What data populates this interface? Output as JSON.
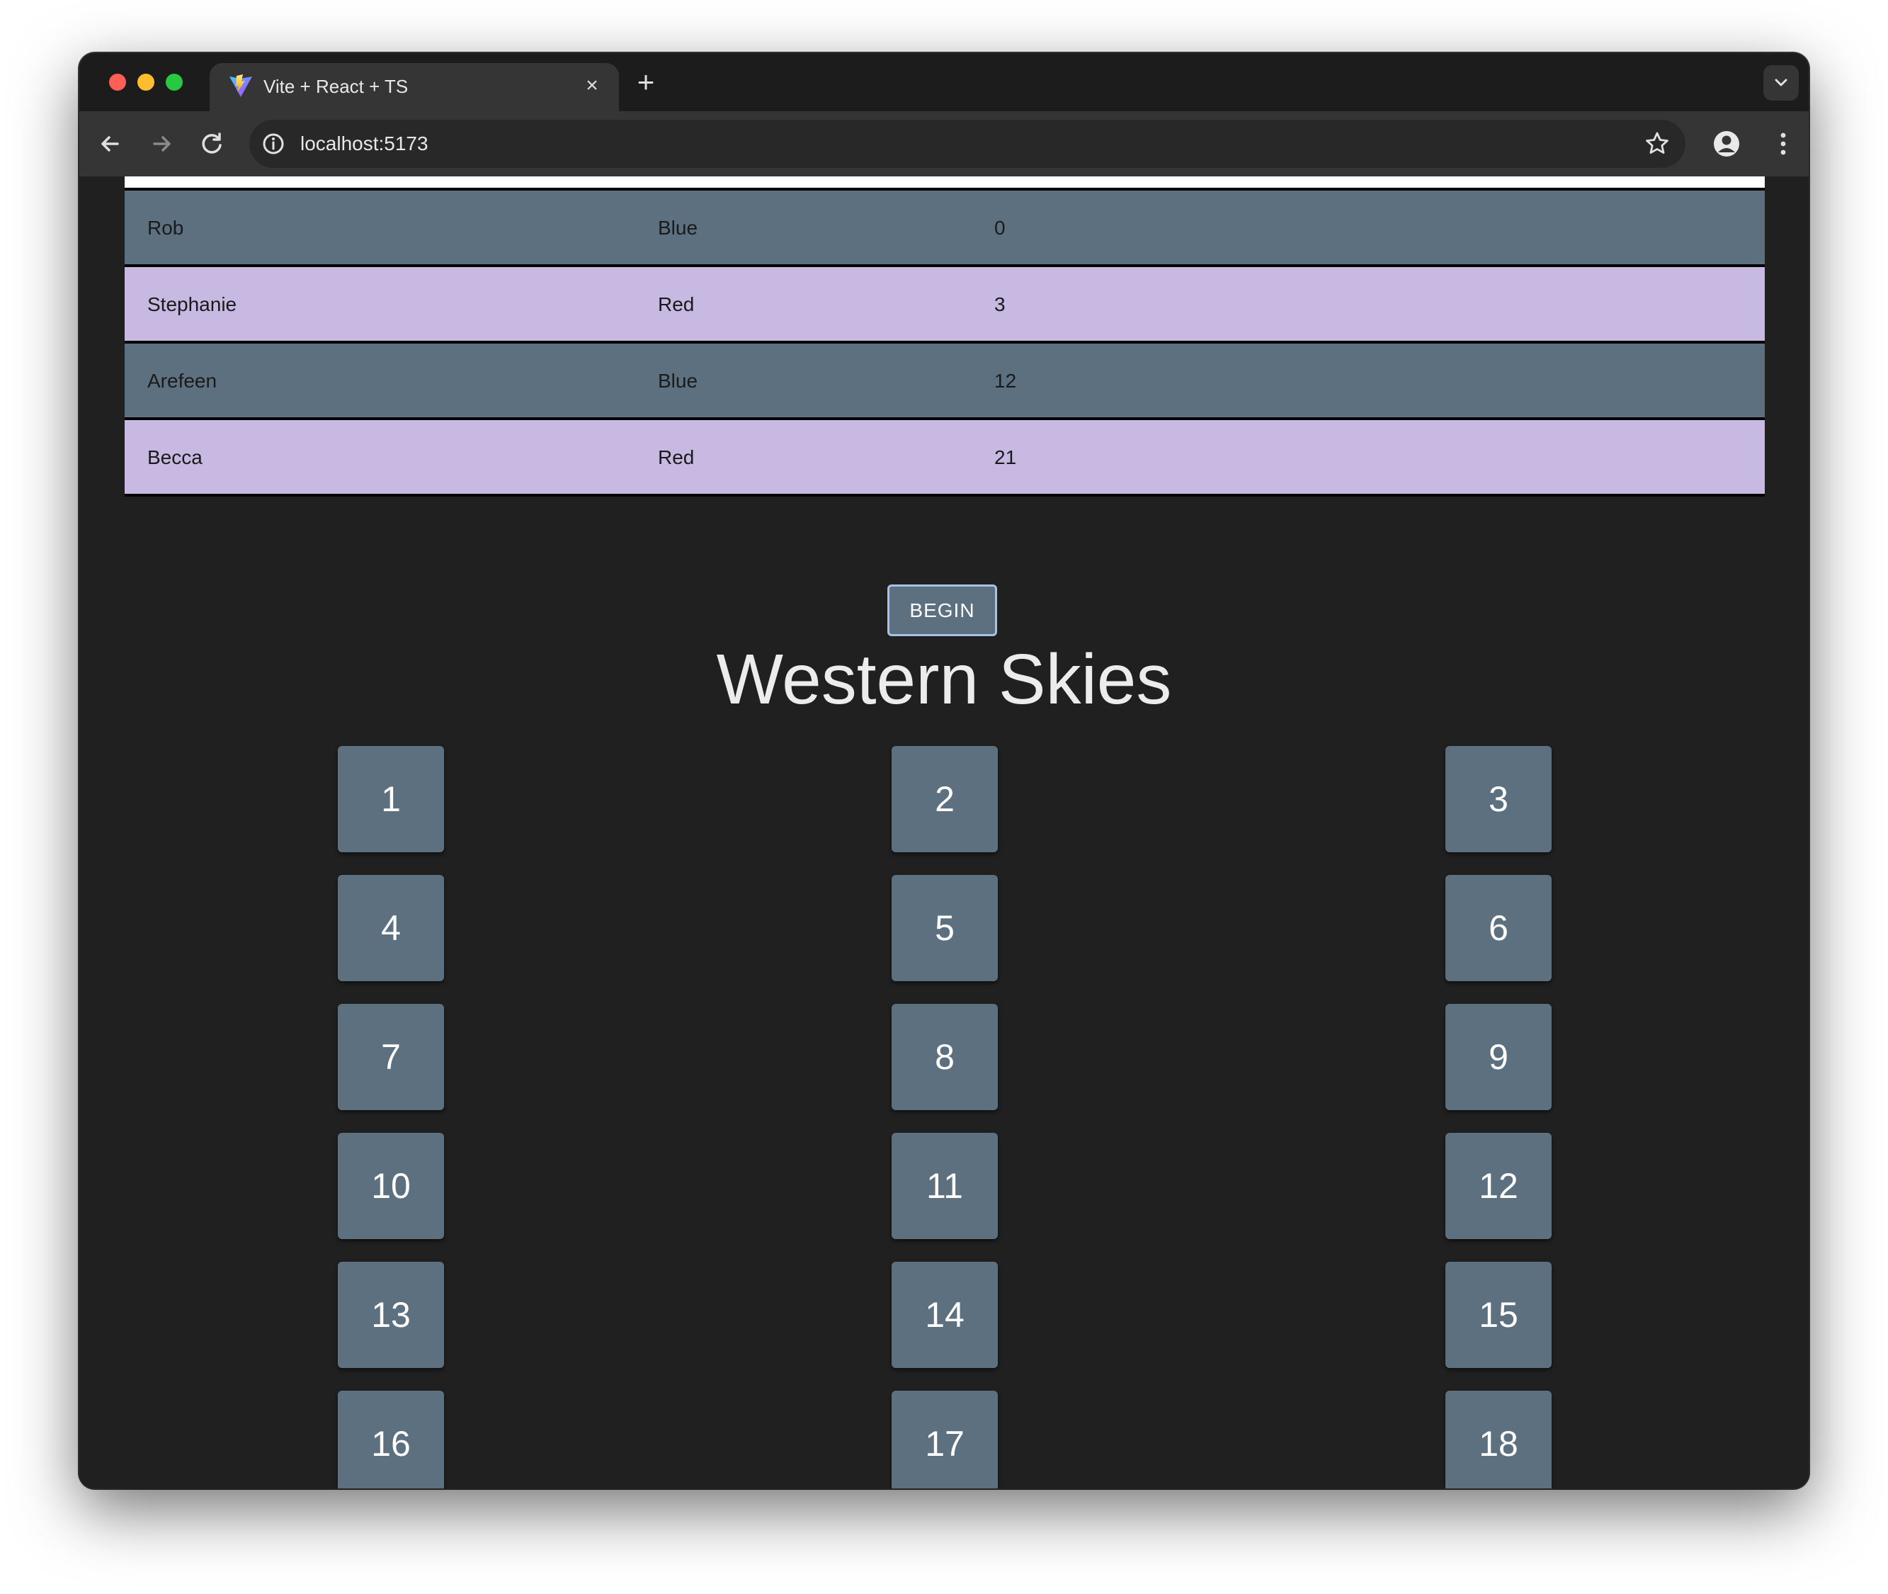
{
  "browser": {
    "tab_title": "Vite + React + TS",
    "tab_close": "×",
    "new_tab": "+",
    "url": "localhost:5173"
  },
  "players": [
    {
      "name": "Rob",
      "team": "Blue",
      "score": "0"
    },
    {
      "name": "Stephanie",
      "team": "Red",
      "score": "3"
    },
    {
      "name": "Arefeen",
      "team": "Blue",
      "score": "12"
    },
    {
      "name": "Becca",
      "team": "Red",
      "score": "21"
    }
  ],
  "colors": {
    "blue_team_row": "#5d7080",
    "red_team_row": "#c8b9e3",
    "tile": "#5d7080",
    "background": "#202020"
  },
  "begin_label": "BEGIN",
  "title": "Western Skies",
  "tiles": [
    "1",
    "2",
    "3",
    "4",
    "5",
    "6",
    "7",
    "8",
    "9",
    "10",
    "11",
    "12",
    "13",
    "14",
    "15",
    "16",
    "17",
    "18"
  ]
}
